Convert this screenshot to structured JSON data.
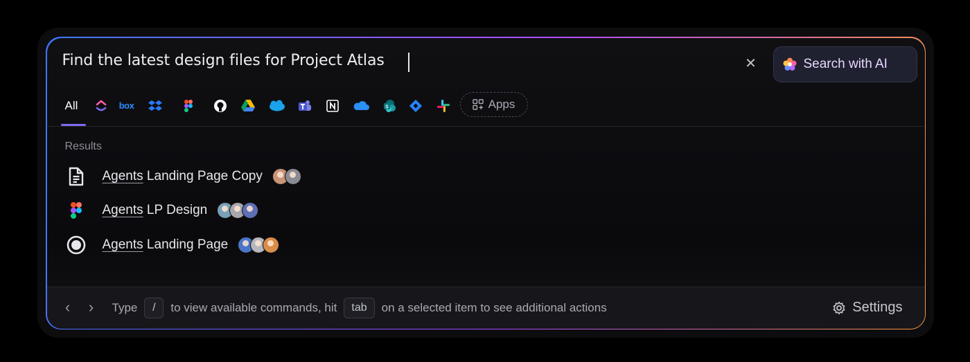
{
  "search": {
    "query": "Find the latest design files for Project Atlas",
    "clear_icon": "close-icon",
    "ai_button_label": "Search with AI",
    "ai_button_icon": "sparkle-flower-icon"
  },
  "filters": {
    "active_tab": "All",
    "apps": [
      {
        "name": "clickup",
        "color": "#7b68ee"
      },
      {
        "name": "box",
        "color": "#1f8fff"
      },
      {
        "name": "dropbox",
        "color": "#2c7bff"
      },
      {
        "name": "figma",
        "color": "#f24e1e"
      },
      {
        "name": "github",
        "color": "#ffffff"
      },
      {
        "name": "google-drive",
        "color": "#fbbc04"
      },
      {
        "name": "salesforce",
        "color": "#1aa3e8"
      },
      {
        "name": "teams",
        "color": "#6264a7"
      },
      {
        "name": "notion",
        "color": "#ffffff"
      },
      {
        "name": "onedrive",
        "color": "#2a8ff7"
      },
      {
        "name": "sharepoint",
        "color": "#0a8f8f"
      },
      {
        "name": "jira",
        "color": "#2684ff"
      },
      {
        "name": "slack",
        "color": "#36c5f0"
      }
    ],
    "apps_button_label": "Apps"
  },
  "results": {
    "label": "Results",
    "items": [
      {
        "highlight": "Agents",
        "rest": " Landing Page Copy",
        "icon": "document-icon",
        "avatars": [
          "#c99577",
          "#8b8b93"
        ]
      },
      {
        "highlight": "Agents",
        "rest": " LP Design",
        "icon": "figma-icon",
        "avatars": [
          "#7aa0b8",
          "#a7a7ad",
          "#5d6fb5"
        ]
      },
      {
        "highlight": "Agents",
        "rest": " Landing Page",
        "icon": "radio-record-icon",
        "avatars": [
          "#4a74c9",
          "#b6b6bd",
          "#d98d4a"
        ]
      }
    ]
  },
  "footer": {
    "hint_type": "Type",
    "slash_key": "/",
    "hint_middle": "to view available commands, hit",
    "tab_key": "tab",
    "hint_end": "on a selected item to see additional actions",
    "settings_label": "Settings",
    "settings_icon": "gear-icon"
  },
  "colors": {
    "accent": "#7c6cf0",
    "border_gradient": [
      "#3d78ff",
      "#b14dff",
      "#ff9a3a"
    ]
  }
}
